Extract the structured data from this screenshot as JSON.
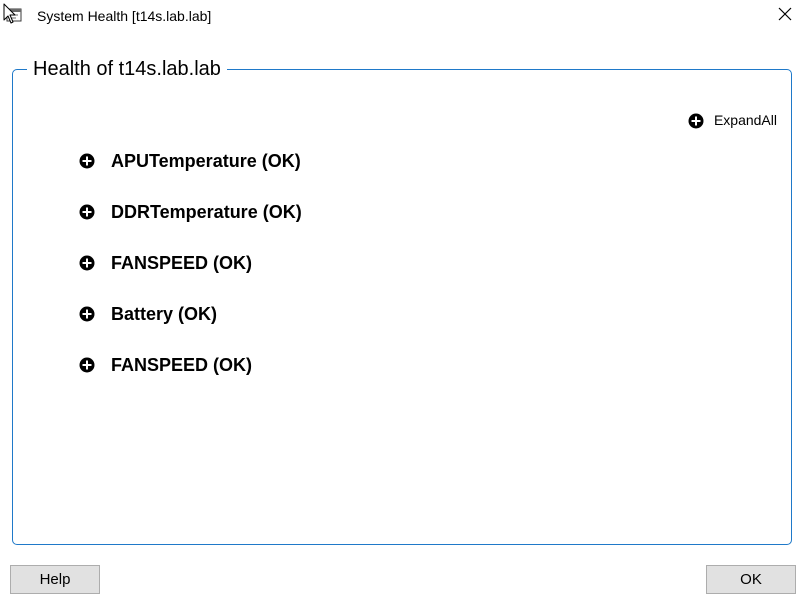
{
  "window": {
    "title": "System Health [t14s.lab.lab]"
  },
  "group": {
    "legend": "Health of t14s.lab.lab",
    "expand_all_label": "ExpandAll"
  },
  "tree": {
    "items": [
      {
        "label": "APUTemperature (OK)"
      },
      {
        "label": "DDRTemperature (OK)"
      },
      {
        "label": "FANSPEED (OK)"
      },
      {
        "label": "Battery (OK)"
      },
      {
        "label": "FANSPEED (OK)"
      }
    ]
  },
  "buttons": {
    "help": "Help",
    "ok": "OK"
  },
  "icons": {
    "app": "window-app-icon",
    "cursor": "mouse-pointer-icon",
    "close": "close-icon",
    "expand": "plus-circle-icon"
  },
  "colors": {
    "group_border": "#1f79c9",
    "button_bg": "#e1e1e1",
    "button_border": "#adadad"
  }
}
